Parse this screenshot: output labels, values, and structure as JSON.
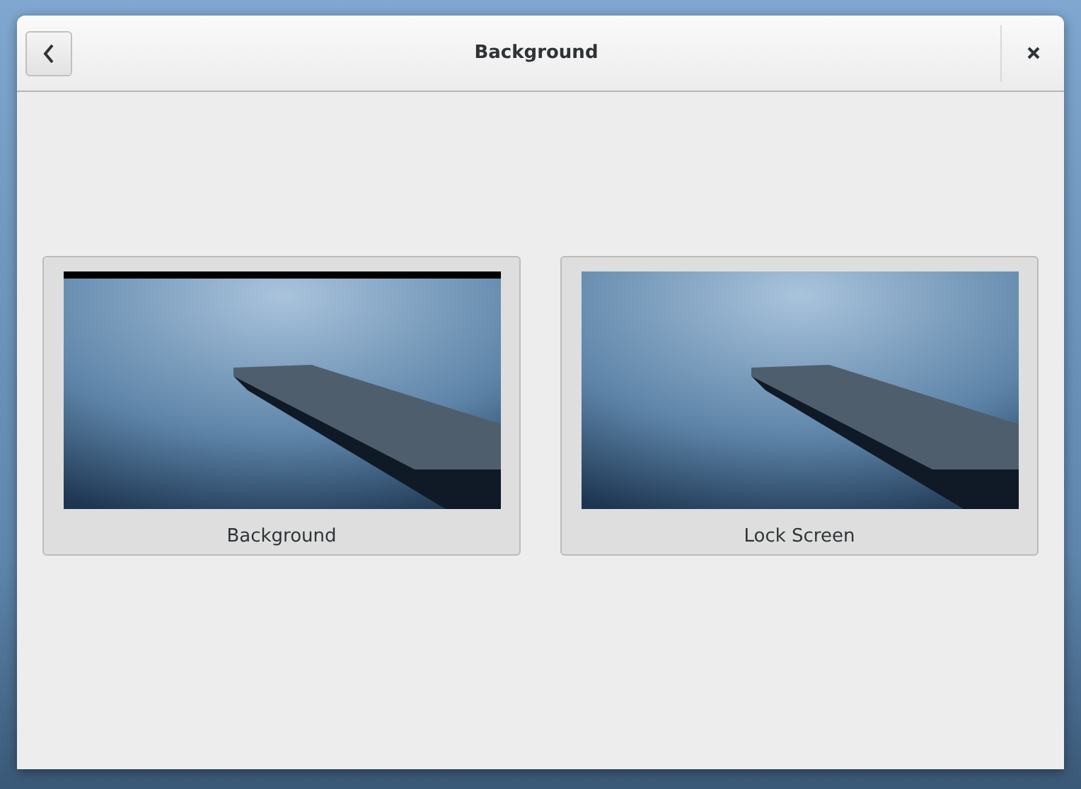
{
  "window": {
    "title": "Background"
  },
  "previews": [
    {
      "label": "Background",
      "kind": "desktop"
    },
    {
      "label": "Lock Screen",
      "kind": "lock"
    }
  ]
}
